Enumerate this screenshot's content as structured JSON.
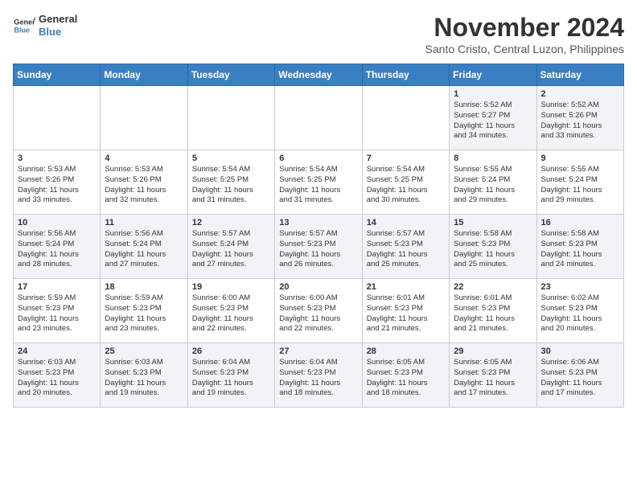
{
  "header": {
    "logo_line1": "General",
    "logo_line2": "Blue",
    "month": "November 2024",
    "location": "Santo Cristo, Central Luzon, Philippines"
  },
  "weekdays": [
    "Sunday",
    "Monday",
    "Tuesday",
    "Wednesday",
    "Thursday",
    "Friday",
    "Saturday"
  ],
  "weeks": [
    [
      {
        "day": "",
        "info": ""
      },
      {
        "day": "",
        "info": ""
      },
      {
        "day": "",
        "info": ""
      },
      {
        "day": "",
        "info": ""
      },
      {
        "day": "",
        "info": ""
      },
      {
        "day": "1",
        "info": "Sunrise: 5:52 AM\nSunset: 5:27 PM\nDaylight: 11 hours\nand 34 minutes."
      },
      {
        "day": "2",
        "info": "Sunrise: 5:52 AM\nSunset: 5:26 PM\nDaylight: 11 hours\nand 33 minutes."
      }
    ],
    [
      {
        "day": "3",
        "info": "Sunrise: 5:53 AM\nSunset: 5:26 PM\nDaylight: 11 hours\nand 33 minutes."
      },
      {
        "day": "4",
        "info": "Sunrise: 5:53 AM\nSunset: 5:26 PM\nDaylight: 11 hours\nand 32 minutes."
      },
      {
        "day": "5",
        "info": "Sunrise: 5:54 AM\nSunset: 5:25 PM\nDaylight: 11 hours\nand 31 minutes."
      },
      {
        "day": "6",
        "info": "Sunrise: 5:54 AM\nSunset: 5:25 PM\nDaylight: 11 hours\nand 31 minutes."
      },
      {
        "day": "7",
        "info": "Sunrise: 5:54 AM\nSunset: 5:25 PM\nDaylight: 11 hours\nand 30 minutes."
      },
      {
        "day": "8",
        "info": "Sunrise: 5:55 AM\nSunset: 5:24 PM\nDaylight: 11 hours\nand 29 minutes."
      },
      {
        "day": "9",
        "info": "Sunrise: 5:55 AM\nSunset: 5:24 PM\nDaylight: 11 hours\nand 29 minutes."
      }
    ],
    [
      {
        "day": "10",
        "info": "Sunrise: 5:56 AM\nSunset: 5:24 PM\nDaylight: 11 hours\nand 28 minutes."
      },
      {
        "day": "11",
        "info": "Sunrise: 5:56 AM\nSunset: 5:24 PM\nDaylight: 11 hours\nand 27 minutes."
      },
      {
        "day": "12",
        "info": "Sunrise: 5:57 AM\nSunset: 5:24 PM\nDaylight: 11 hours\nand 27 minutes."
      },
      {
        "day": "13",
        "info": "Sunrise: 5:57 AM\nSunset: 5:23 PM\nDaylight: 11 hours\nand 26 minutes."
      },
      {
        "day": "14",
        "info": "Sunrise: 5:57 AM\nSunset: 5:23 PM\nDaylight: 11 hours\nand 25 minutes."
      },
      {
        "day": "15",
        "info": "Sunrise: 5:58 AM\nSunset: 5:23 PM\nDaylight: 11 hours\nand 25 minutes."
      },
      {
        "day": "16",
        "info": "Sunrise: 5:58 AM\nSunset: 5:23 PM\nDaylight: 11 hours\nand 24 minutes."
      }
    ],
    [
      {
        "day": "17",
        "info": "Sunrise: 5:59 AM\nSunset: 5:23 PM\nDaylight: 11 hours\nand 23 minutes."
      },
      {
        "day": "18",
        "info": "Sunrise: 5:59 AM\nSunset: 5:23 PM\nDaylight: 11 hours\nand 23 minutes."
      },
      {
        "day": "19",
        "info": "Sunrise: 6:00 AM\nSunset: 5:23 PM\nDaylight: 11 hours\nand 22 minutes."
      },
      {
        "day": "20",
        "info": "Sunrise: 6:00 AM\nSunset: 5:23 PM\nDaylight: 11 hours\nand 22 minutes."
      },
      {
        "day": "21",
        "info": "Sunrise: 6:01 AM\nSunset: 5:23 PM\nDaylight: 11 hours\nand 21 minutes."
      },
      {
        "day": "22",
        "info": "Sunrise: 6:01 AM\nSunset: 5:23 PM\nDaylight: 11 hours\nand 21 minutes."
      },
      {
        "day": "23",
        "info": "Sunrise: 6:02 AM\nSunset: 5:23 PM\nDaylight: 11 hours\nand 20 minutes."
      }
    ],
    [
      {
        "day": "24",
        "info": "Sunrise: 6:03 AM\nSunset: 5:23 PM\nDaylight: 11 hours\nand 20 minutes."
      },
      {
        "day": "25",
        "info": "Sunrise: 6:03 AM\nSunset: 5:23 PM\nDaylight: 11 hours\nand 19 minutes."
      },
      {
        "day": "26",
        "info": "Sunrise: 6:04 AM\nSunset: 5:23 PM\nDaylight: 11 hours\nand 19 minutes."
      },
      {
        "day": "27",
        "info": "Sunrise: 6:04 AM\nSunset: 5:23 PM\nDaylight: 11 hours\nand 18 minutes."
      },
      {
        "day": "28",
        "info": "Sunrise: 6:05 AM\nSunset: 5:23 PM\nDaylight: 11 hours\nand 18 minutes."
      },
      {
        "day": "29",
        "info": "Sunrise: 6:05 AM\nSunset: 5:23 PM\nDaylight: 11 hours\nand 17 minutes."
      },
      {
        "day": "30",
        "info": "Sunrise: 6:06 AM\nSunset: 5:23 PM\nDaylight: 11 hours\nand 17 minutes."
      }
    ]
  ]
}
